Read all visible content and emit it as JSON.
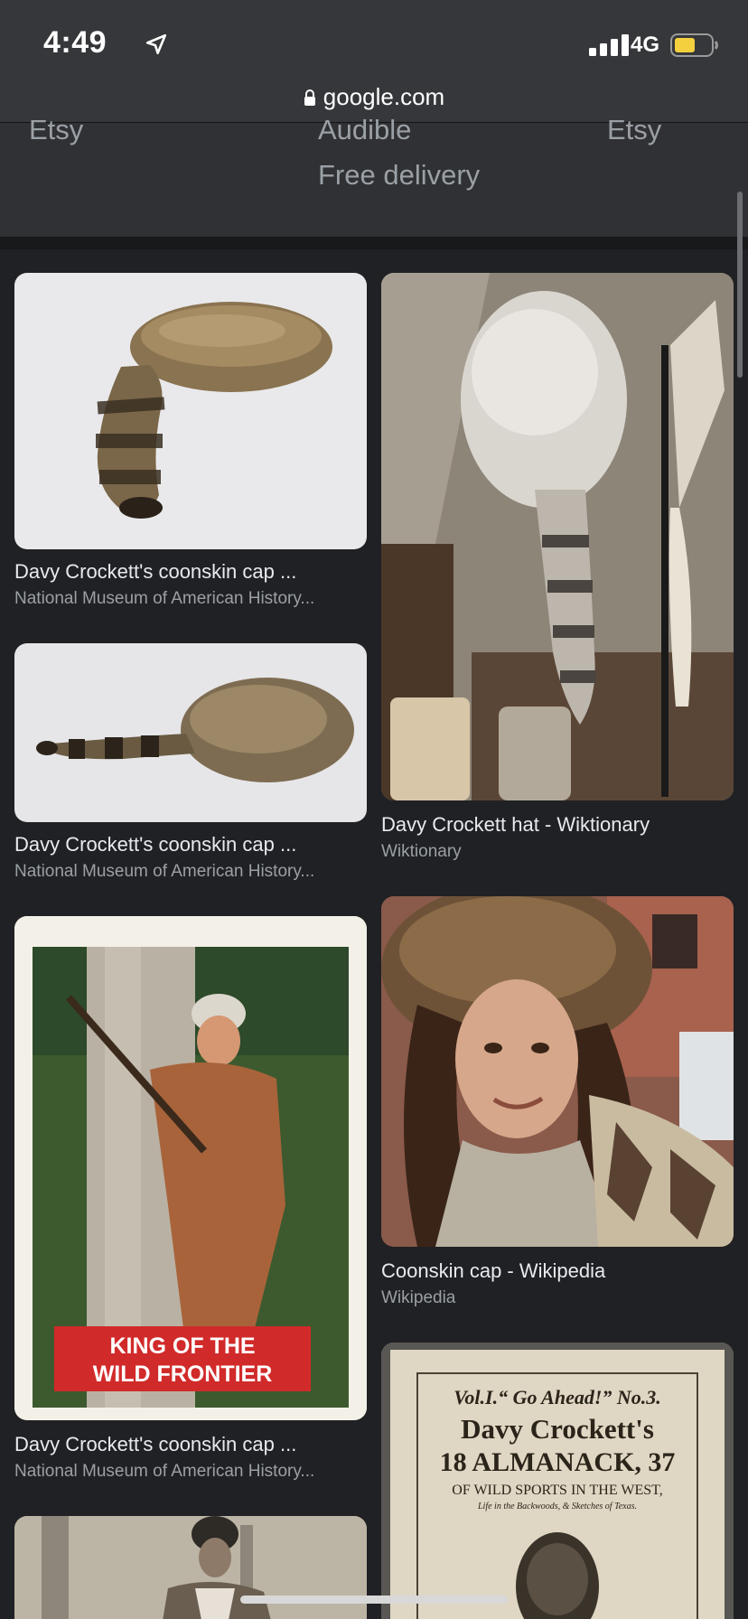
{
  "status_bar": {
    "time": "4:49",
    "network": "4G",
    "battery_color": "#f4d03f"
  },
  "browser": {
    "url": "google.com"
  },
  "shopping_strip": {
    "row1": [
      "Etsy",
      "Audible",
      "Etsy"
    ],
    "row2": "Free delivery"
  },
  "results": [
    {
      "title": "Davy Crockett's coonskin cap ...",
      "source": "National Museum of American History..."
    },
    {
      "title": "Davy Crockett hat - Wiktionary",
      "source": "Wiktionary"
    },
    {
      "title": "Davy Crockett's coonskin cap ...",
      "source": "National Museum of American History..."
    },
    {
      "title": "Coonskin cap - Wikipedia",
      "source": "Wikipedia"
    },
    {
      "title": "Davy Crockett's coonskin cap ...",
      "source": "National Museum of American History..."
    }
  ],
  "image_texts": {
    "card_banner_1": "KING OF THE",
    "card_banner_2": "WILD FRONTIER",
    "almanac_line1": "Vol.I.“ Go Ahead!” No.3.",
    "almanac_line2": "Davy Crockett's",
    "almanac_line3": "18 ALMANACK, 37",
    "almanac_line4": "OF WILD SPORTS IN THE WEST,",
    "almanac_line5": "Life in the Backwoods, & Sketches of Texas."
  }
}
